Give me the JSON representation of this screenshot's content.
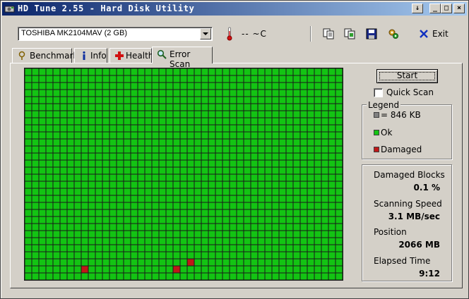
{
  "window": {
    "title": "HD Tune 2.55 - Hard Disk Utility",
    "buttons": [
      "↓",
      "_",
      "□",
      "×"
    ]
  },
  "toolbar": {
    "drive": "TOSHIBA MK2104MAV (2 GB)",
    "temperature": "-- ~C",
    "icons": [
      "copy-text-icon",
      "copy-screenshot-icon",
      "save-icon",
      "options-icon"
    ],
    "exit_label": "Exit"
  },
  "tabs": [
    {
      "label": "Benchmark",
      "icon": "benchmark-icon",
      "active": false
    },
    {
      "label": "Info",
      "icon": "info-icon",
      "active": false
    },
    {
      "label": "Health",
      "icon": "health-icon",
      "active": false
    },
    {
      "label": "Error Scan",
      "icon": "error-scan-icon",
      "active": true
    }
  ],
  "scan": {
    "start_label": "Start",
    "quick_scan_label": "Quick Scan",
    "quick_scan_checked": false,
    "grid": {
      "columns": 45,
      "rows": 30,
      "ok_color": "#13c413",
      "damaged_color": "#c01818",
      "damaged_cells": [
        [
          8,
          28
        ],
        [
          21,
          28
        ],
        [
          23,
          27
        ]
      ]
    }
  },
  "legend": {
    "title": "Legend",
    "block_size": "= 846 KB",
    "ok_label": "Ok",
    "damaged_label": "Damaged",
    "block_color": "#808080",
    "ok_color": "#13c413",
    "damaged_color": "#c01818"
  },
  "stats": {
    "damaged_blocks_label": "Damaged Blocks",
    "damaged_blocks_value": "0.1 %",
    "speed_label": "Scanning Speed",
    "speed_value": "3.1 MB/sec",
    "position_label": "Position",
    "position_value": "2066 MB",
    "elapsed_label": "Elapsed Time",
    "elapsed_value": "9:12"
  }
}
